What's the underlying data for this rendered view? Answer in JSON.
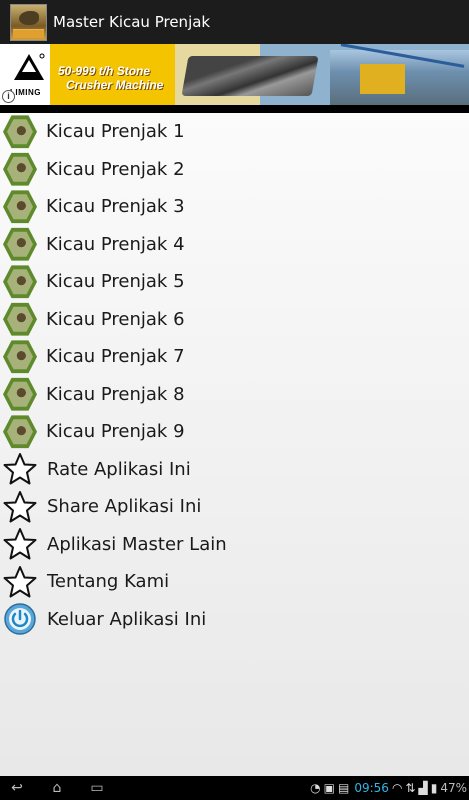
{
  "app": {
    "title": "Master Kicau Prenjak",
    "icon": "bird-app-icon"
  },
  "ad": {
    "brand": "LIMING",
    "line1": "50-999 t/h Stone",
    "line2": "Crusher Machine",
    "info_icon": "i"
  },
  "menu": [
    {
      "label": "Kicau Prenjak 1",
      "icon": "bird-thumbnail"
    },
    {
      "label": "Kicau Prenjak 2",
      "icon": "bird-thumbnail"
    },
    {
      "label": "Kicau Prenjak 3",
      "icon": "bird-thumbnail"
    },
    {
      "label": "Kicau Prenjak 4",
      "icon": "bird-thumbnail"
    },
    {
      "label": "Kicau Prenjak 5",
      "icon": "bird-thumbnail"
    },
    {
      "label": "Kicau Prenjak 6",
      "icon": "bird-thumbnail"
    },
    {
      "label": "Kicau Prenjak 7",
      "icon": "bird-thumbnail"
    },
    {
      "label": "Kicau Prenjak 8",
      "icon": "bird-thumbnail"
    },
    {
      "label": "Kicau Prenjak 9",
      "icon": "bird-thumbnail"
    },
    {
      "label": "Rate Aplikasi Ini",
      "icon": "star-icon"
    },
    {
      "label": "Share Aplikasi Ini",
      "icon": "star-icon"
    },
    {
      "label": "Aplikasi Master Lain",
      "icon": "star-icon"
    },
    {
      "label": "Tentang Kami",
      "icon": "star-icon"
    },
    {
      "label": "Keluar Aplikasi Ini",
      "icon": "power-icon"
    }
  ],
  "statusbar": {
    "time": "09:56",
    "battery": "47%"
  },
  "colors": {
    "accent": "#33b5e5",
    "titlebar": "#1c1c1c"
  }
}
